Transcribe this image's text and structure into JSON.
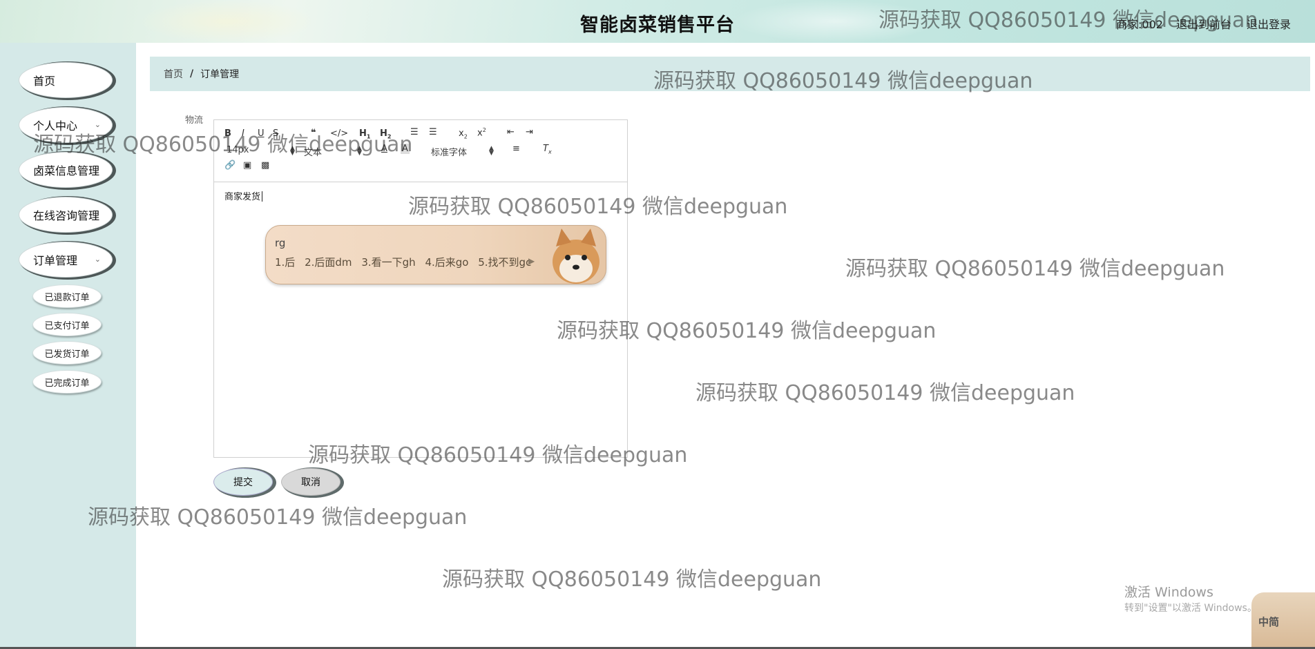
{
  "header": {
    "title": "智能卤菜销售平台",
    "links": [
      "商家:002",
      "退出到前台",
      "退出登录"
    ]
  },
  "sidebar": {
    "items": [
      {
        "label": "首页"
      },
      {
        "label": "个人中心"
      },
      {
        "label": "卤菜信息管理"
      },
      {
        "label": "在线咨询管理"
      },
      {
        "label": "订单管理"
      }
    ],
    "order_sub_items": [
      "已退款订单",
      "已支付订单",
      "已发货订单",
      "已完成订单"
    ]
  },
  "breadcrumb": {
    "home": "首页",
    "separator": "/",
    "current": "订单管理"
  },
  "form": {
    "field_label": "物流",
    "toolbar": {
      "font_size": "14px",
      "text_style": "文本",
      "font_family": "标准字体"
    },
    "editor_content": "商家发货",
    "submit_label": "提交",
    "cancel_label": "取消"
  },
  "ime_popup": {
    "input": "rg",
    "candidates": [
      "1.后",
      "2.后面dm",
      "3.看一下gh",
      "4.后来go",
      "5.找不到gc"
    ]
  },
  "watermark_text": "源码获取 QQ86050149 微信deepguan",
  "windows_activation": {
    "title": "激活 Windows",
    "subtitle": "转到\"设置\"以激活 Windows。"
  },
  "ime_badge_label": "中简",
  "colors": {
    "sidebar_bg": "#d5e9e8",
    "breadcrumb_bg": "#d5e9e8",
    "pill_shadow": "#4d5757",
    "ime_bg": "#efd6bd"
  }
}
